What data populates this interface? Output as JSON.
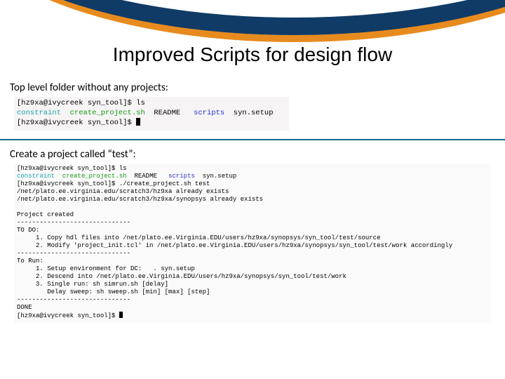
{
  "title": "Improved Scripts for design flow",
  "caption1": "Top level folder without any projects:",
  "caption2": "Create a project called “test”:",
  "term1": {
    "l1_prompt": "[hz9xa@ivycreek syn_tool]$ ",
    "l1_cmd": "ls",
    "l2a": "constraint",
    "l2b": "create_project.sh",
    "l2c": "README",
    "l2d": "scripts",
    "l2e": "syn.setup",
    "l3_prompt": "[hz9xa@ivycreek syn_tool]$ "
  },
  "term2": {
    "p1": "[hz9xa@ivycreek syn_tool]$ ",
    "c1": "ls",
    "la": "constraint",
    "lb": "create_project.sh",
    "lc": "README",
    "ld": "scripts",
    "le": "syn.setup",
    "p2": "[hz9xa@ivycreek syn_tool]$ ",
    "c2": "./create_project.sh test",
    "o1": "/net/plato.ee.virginia.edu/scratch3/hz9xa already exists",
    "o2": "/net/plato.ee.virginia.edu/scratch3/hz9xa/synopsys already exists",
    "blank": "",
    "o3": "Project created",
    "dash": "------------------------------",
    "o4": "TO DO:",
    "o5": "     1. Copy hdl files into /net/plato.ee.Virginia.EDU/users/hz9xa/synopsys/syn_tool/test/source",
    "o6": "     2. Modify 'project_init.tcl' in /net/plato.ee.Virginia.EDU/users/hz9xa/synopsys/syn_tool/test/work accordingly",
    "o7": "To Run:",
    "o8": "     1. Setup environment for DC:   . syn.setup",
    "o9": "     2. Descend into /net/plato.ee.Virginia.EDU/users/hz9xa/synopsys/syn_tool/test/work",
    "o10": "     3. Single run: sh simrun.sh [delay]",
    "o11": "        Delay sweep: sh sweep.sh [min] [max] [step]",
    "o12": "DONE",
    "p3": "[hz9xa@ivycreek syn_tool]$ "
  }
}
